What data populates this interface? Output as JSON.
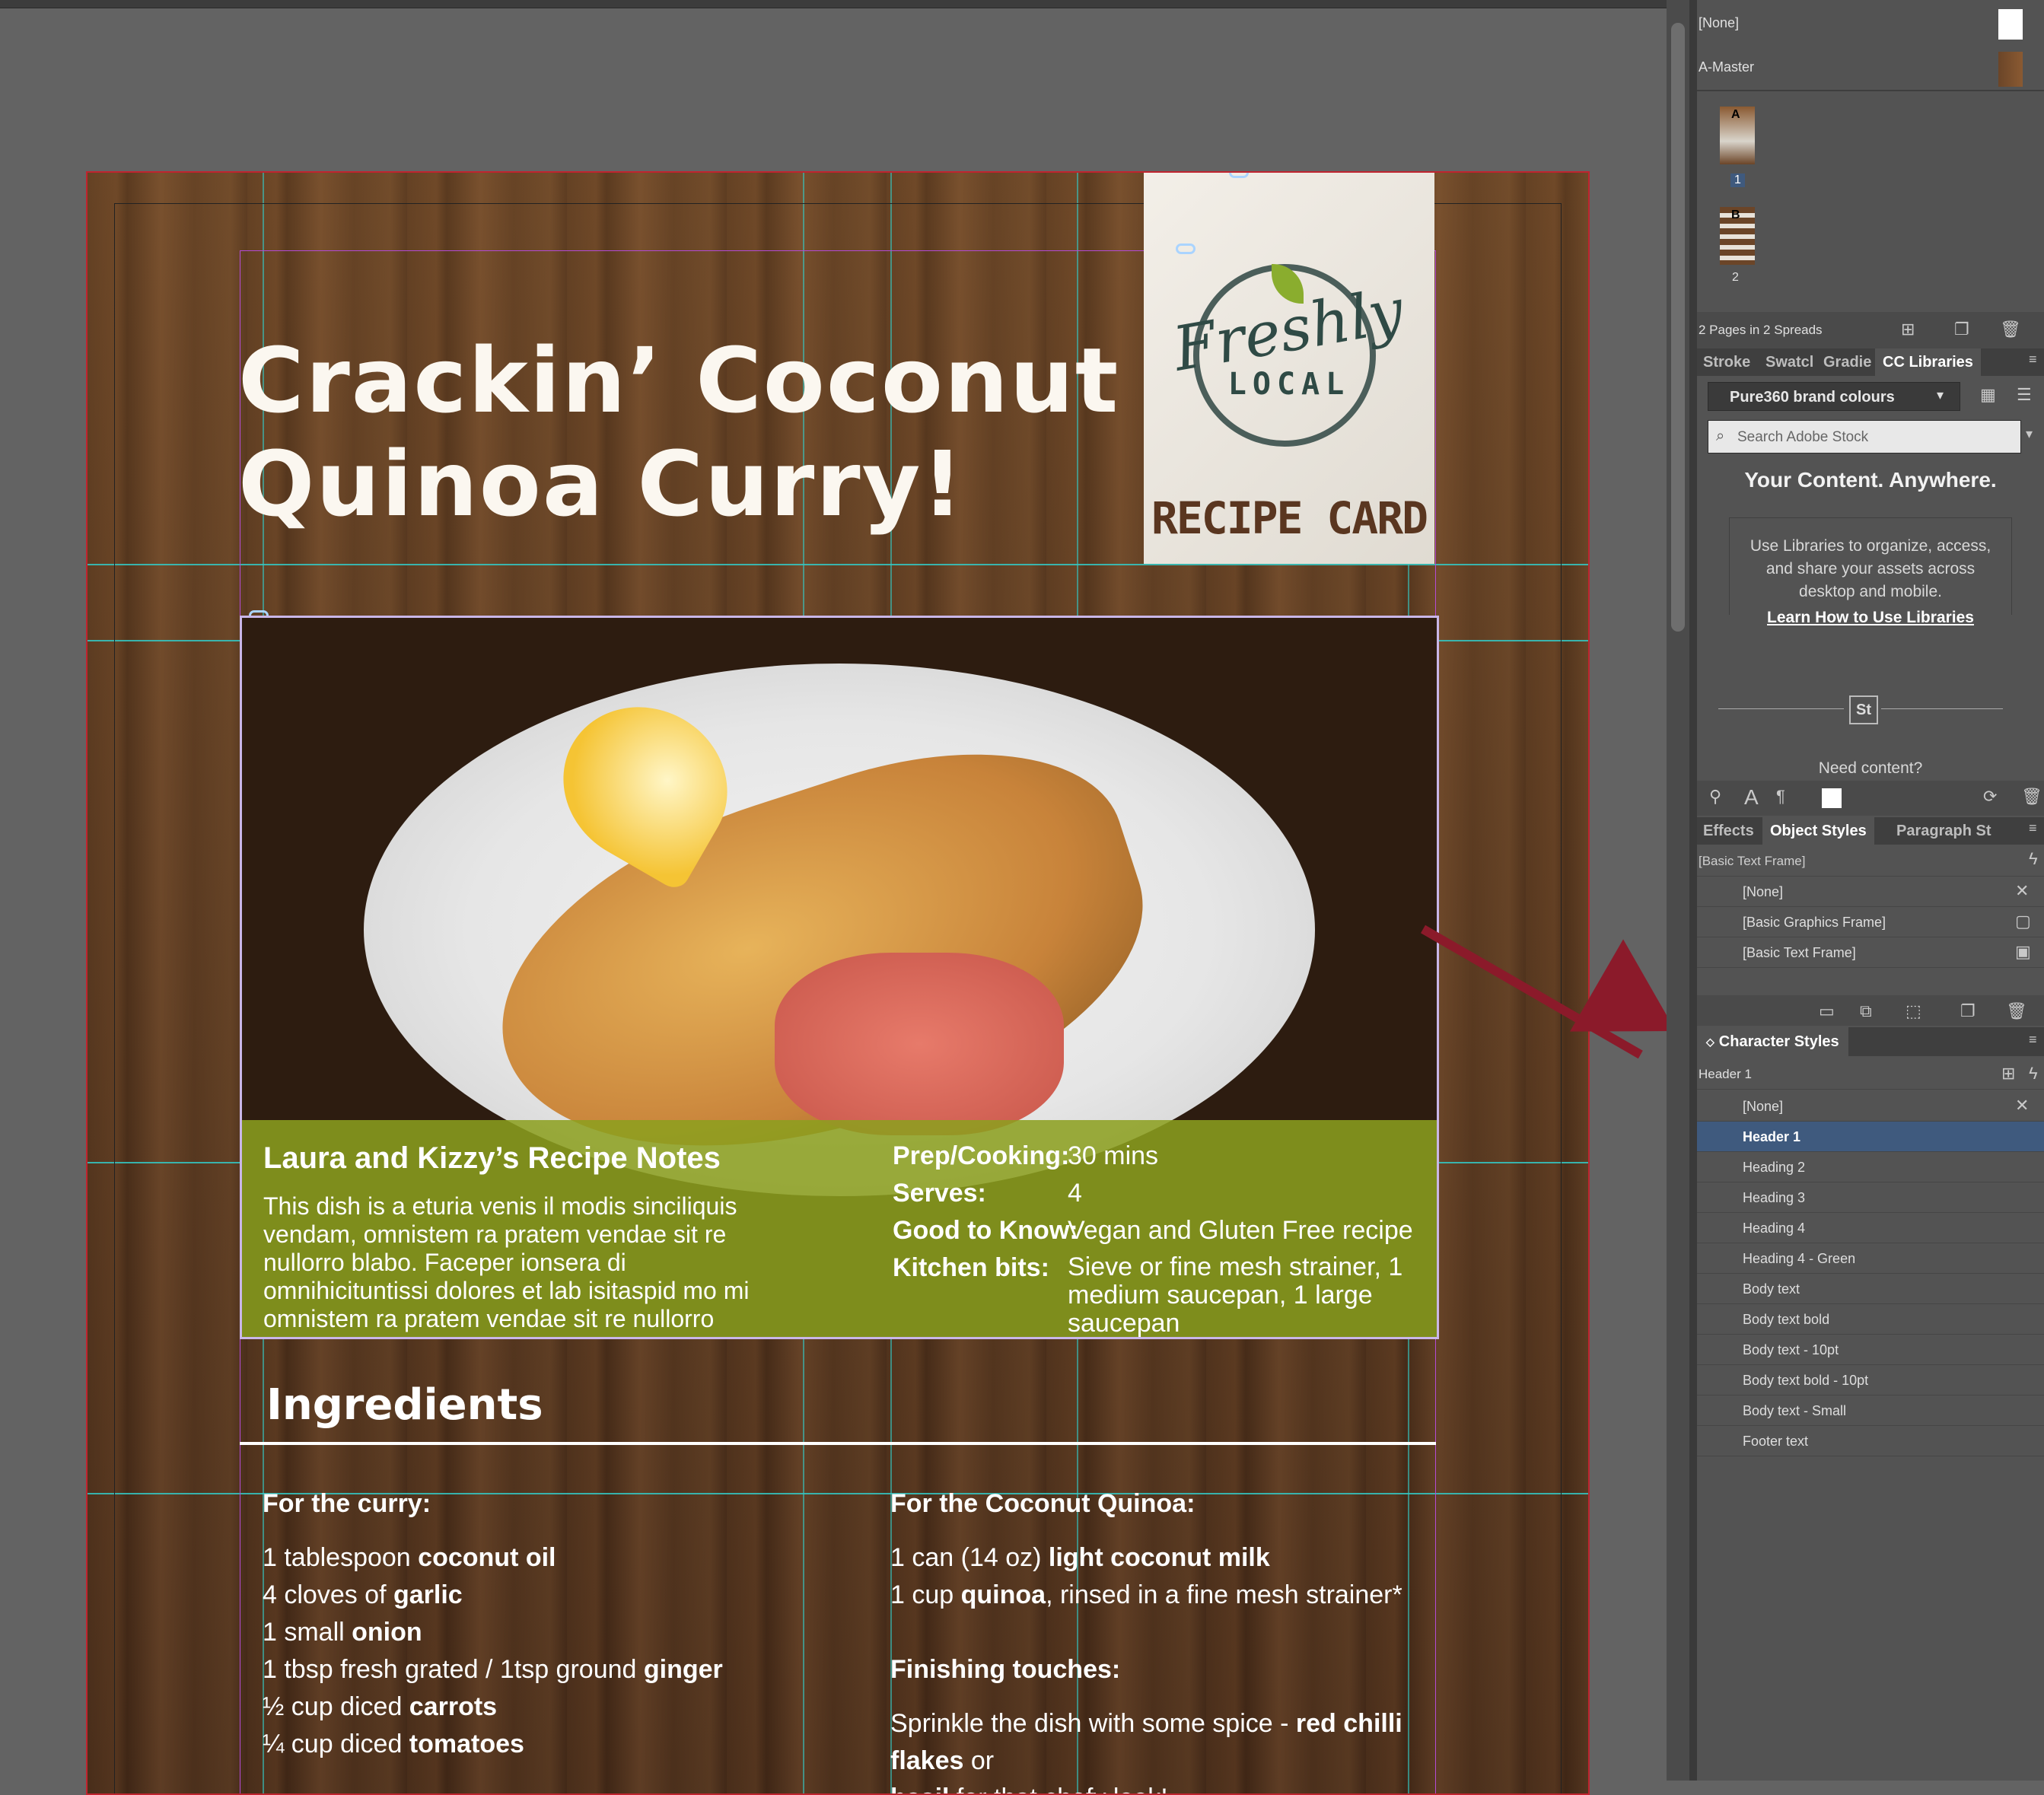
{
  "document": {
    "title_line1": "Crackin’  Coconut",
    "title_line2": "Quinoa Curry!",
    "logo_script": "Freshly",
    "logo_local": "LOCAL",
    "recipe_card": "RECIPE CARD",
    "notes_heading": "Laura and Kizzy’s Recipe Notes",
    "notes_body": "This dish is a eturia venis il modis sinciliquis vendam, omnistem ra pratem vendae sit re nullorro blabo. Faceper ionsera di omnihicituntissi dolores et lab isitaspid mo mi omnistem ra pratem vendae sit re nullorro blab!",
    "info": [
      {
        "k": "Prep/Cooking:",
        "v": "30 mins"
      },
      {
        "k": "Serves:",
        "v": "4"
      },
      {
        "k": "Good to Know:",
        "v": "Vegan and Gluten Free recipe"
      },
      {
        "k": "Kitchen bits:",
        "v": "Sieve or fine mesh strainer, 1 medium saucepan, 1 large saucepan"
      }
    ],
    "ingredients_heading": "Ingredients",
    "curry_heading": "For the curry:",
    "curry_items": [
      {
        "pre": "1 tablespoon ",
        "bold": "coconut oil"
      },
      {
        "pre": "4 cloves of ",
        "bold": "garlic"
      },
      {
        "pre": "1 small ",
        "bold": "onion"
      },
      {
        "pre": "1 tbsp fresh grated / 1tsp ground ",
        "bold": "ginger"
      },
      {
        "pre": "½ cup diced ",
        "bold": "carrots"
      },
      {
        "pre": "¼ cup diced ",
        "bold": "tomatoes"
      }
    ],
    "quinoa_heading": "For the Coconut Quinoa:",
    "quinoa_items": [
      {
        "pre": "1 can (14 oz) ",
        "bold": "light coconut milk",
        "post": ""
      },
      {
        "pre": "1 cup ",
        "bold": "quinoa",
        "post": ", rinsed in a fine mesh strainer*"
      }
    ],
    "finishing_heading": "Finishing touches:",
    "finishing_line1_pre": "Sprinkle the dish with some spice - ",
    "finishing_line1_bold": "red chilli flakes",
    "finishing_line1_post": " or",
    "finishing_line2_bold": "basil",
    "finishing_line2_post": " for that chefy look!"
  },
  "pages_panel": {
    "masters": [
      "[None]",
      "A-Master"
    ],
    "pages": [
      {
        "num": "1",
        "master": "A"
      },
      {
        "num": "2",
        "master": "B"
      }
    ],
    "summary": "2 Pages in 2 Spreads"
  },
  "libraries_panel": {
    "tabs": [
      "Stroke",
      "Swatcl",
      "Gradie",
      "CC Libraries"
    ],
    "library_select": "Pure360 brand colours",
    "search_placeholder": "Search Adobe Stock",
    "headline": "Your Content. Anywhere.",
    "body": "Use Libraries to organize, access, and share your assets across desktop and mobile.",
    "link": "Learn How to Use Libraries",
    "stock_badge": "St",
    "need_content": "Need content?"
  },
  "object_styles_panel": {
    "tabs": [
      "Effects",
      "Object Styles",
      "Paragraph St"
    ],
    "current": "[Basic Text Frame]",
    "items": [
      "[None]",
      "[Basic Graphics Frame]",
      "[Basic Text Frame]"
    ]
  },
  "character_styles_panel": {
    "title": "Character Styles",
    "current": "Header 1",
    "items": [
      "[None]",
      "Header 1",
      "Heading 2",
      "Heading 3",
      "Heading 4",
      "Heading 4 - Green",
      "Body text",
      "Body text bold",
      "Body text - 10pt",
      "Body text bold - 10pt",
      "Body text - Small",
      "Footer text"
    ],
    "selected": "Header 1"
  },
  "colors": {
    "accent_selection": "#3f5a7e",
    "arrow": "#8b1a2a",
    "notes_band": "#8ca01e",
    "guide": "#33c9c6"
  }
}
